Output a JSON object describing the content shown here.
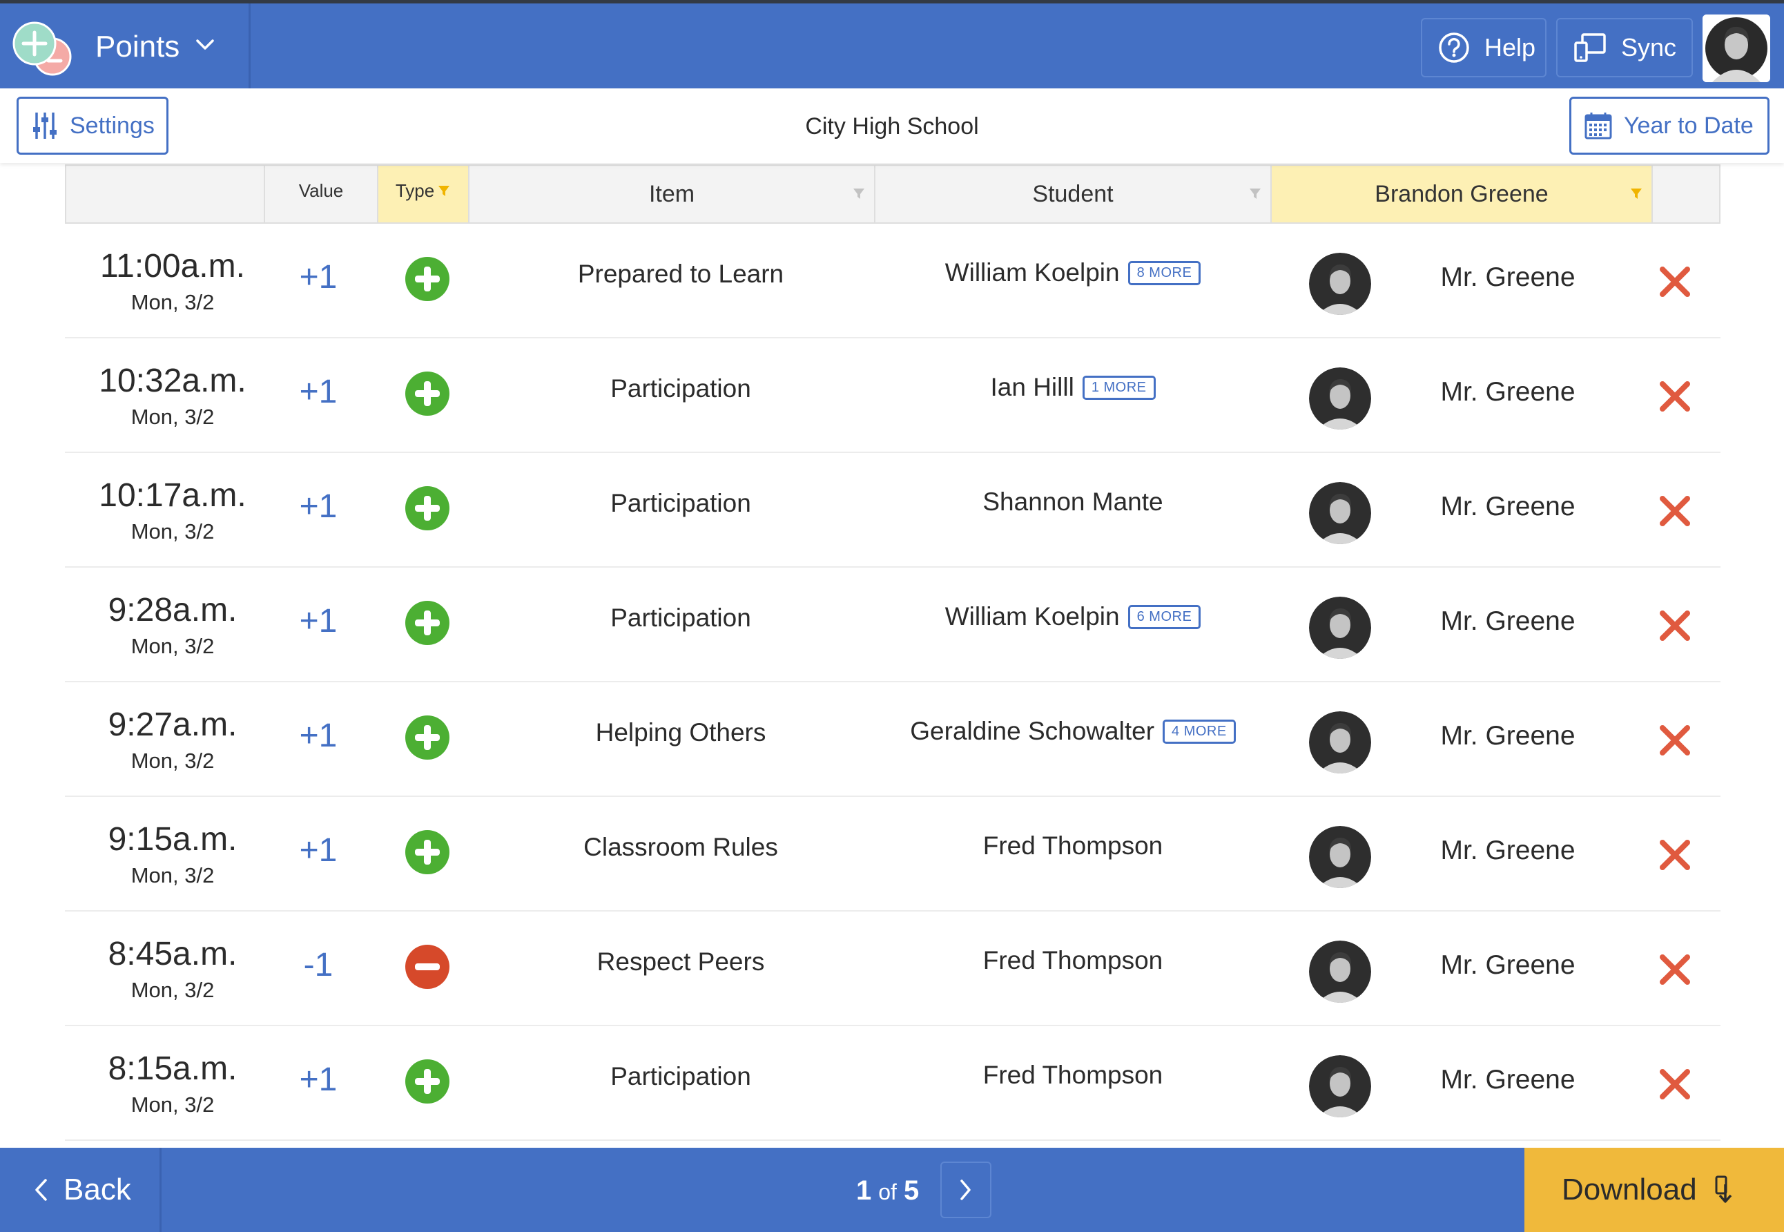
{
  "header": {
    "app_title": "Points",
    "help_label": "Help",
    "sync_label": "Sync"
  },
  "subbar": {
    "settings_label": "Settings",
    "school_name": "City High School",
    "date_range_label": "Year to Date"
  },
  "table": {
    "columns": {
      "value": "Value",
      "type": "Type",
      "item": "Item",
      "student": "Student",
      "staff": "Brandon Greene"
    },
    "rows": [
      {
        "time": "11:00a.m.",
        "date": "Mon, 3/2",
        "value": "+1",
        "type": "positive",
        "item": "Prepared to Learn",
        "student": "William Koelpin",
        "more": "8 MORE",
        "staff": "Mr. Greene"
      },
      {
        "time": "10:32a.m.",
        "date": "Mon, 3/2",
        "value": "+1",
        "type": "positive",
        "item": "Participation",
        "student": "Ian Hilll",
        "more": "1 MORE",
        "staff": "Mr. Greene"
      },
      {
        "time": "10:17a.m.",
        "date": "Mon, 3/2",
        "value": "+1",
        "type": "positive",
        "item": "Participation",
        "student": "Shannon Mante",
        "more": "",
        "staff": "Mr. Greene"
      },
      {
        "time": "9:28a.m.",
        "date": "Mon, 3/2",
        "value": "+1",
        "type": "positive",
        "item": "Participation",
        "student": "William Koelpin",
        "more": "6 MORE",
        "staff": "Mr. Greene"
      },
      {
        "time": "9:27a.m.",
        "date": "Mon, 3/2",
        "value": "+1",
        "type": "positive",
        "item": "Helping Others",
        "student": "Geraldine Schowalter",
        "more": "4 MORE",
        "staff": "Mr. Greene"
      },
      {
        "time": "9:15a.m.",
        "date": "Mon, 3/2",
        "value": "+1",
        "type": "positive",
        "item": "Classroom Rules",
        "student": "Fred Thompson",
        "more": "",
        "staff": "Mr. Greene"
      },
      {
        "time": "8:45a.m.",
        "date": "Mon, 3/2",
        "value": "-1",
        "type": "negative",
        "item": "Respect Peers",
        "student": "Fred Thompson",
        "more": "",
        "staff": "Mr. Greene"
      },
      {
        "time": "8:15a.m.",
        "date": "Mon, 3/2",
        "value": "+1",
        "type": "positive",
        "item": "Participation",
        "student": "Fred Thompson",
        "more": "",
        "staff": "Mr. Greene"
      }
    ]
  },
  "footer": {
    "back_label": "Back",
    "page_current": "1",
    "page_of": "of",
    "page_total": "5",
    "download_label": "Download"
  },
  "icons": {
    "positive": "plus-circle-icon",
    "negative": "minus-circle-icon",
    "delete": "delete-x-icon"
  },
  "colors": {
    "brand_blue": "#4470c4",
    "positive_green": "#4caf33",
    "negative_red": "#d6492a",
    "delete_red": "#e05a3f",
    "highlight_yellow": "#fdf0b4",
    "download_gold": "#f0b93b"
  }
}
